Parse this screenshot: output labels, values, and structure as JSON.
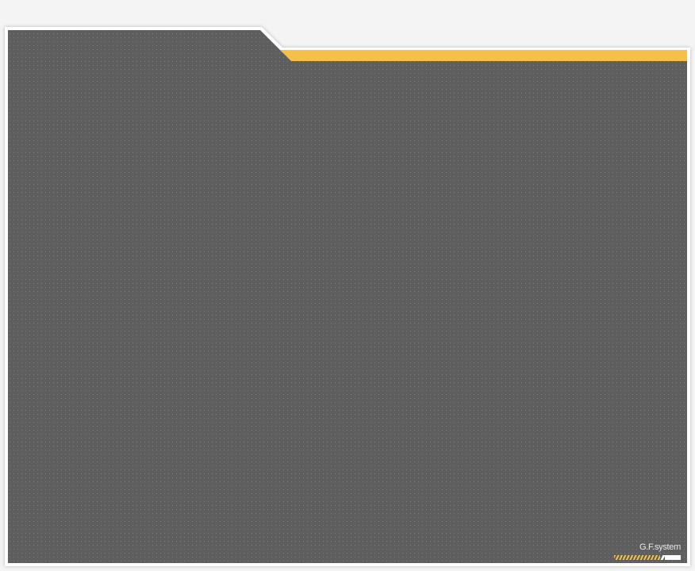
{
  "theme": {
    "accent_color": "#f5c04a",
    "panel_color": "#5e5e5e",
    "dot_color": "#7a7a7a",
    "frame_color": "#ffffff",
    "background_color": "#f4f4f4"
  },
  "brand": {
    "text": "G.F.system",
    "icon": "stripe-logo-icon"
  }
}
